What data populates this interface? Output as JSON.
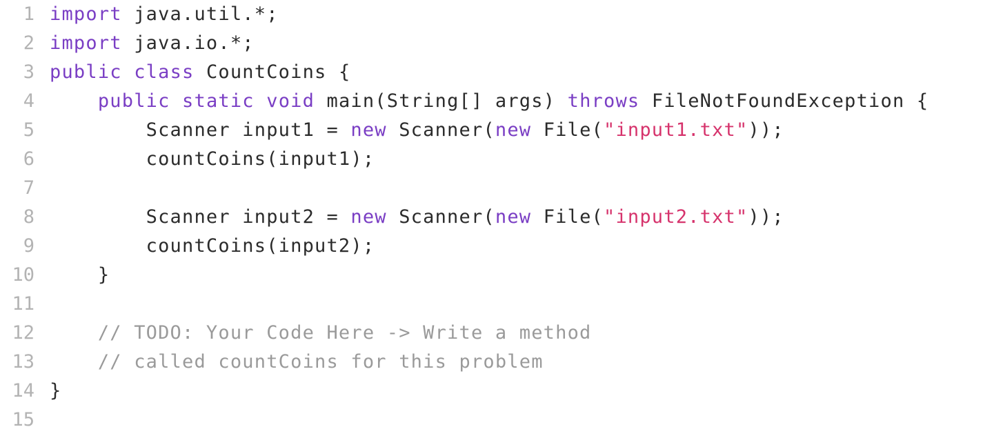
{
  "editor": {
    "language": "java",
    "lines": [
      {
        "number": "1",
        "tokens": [
          {
            "t": "kw",
            "v": "import"
          },
          {
            "t": "plain",
            "v": " java.util.*;"
          }
        ]
      },
      {
        "number": "2",
        "tokens": [
          {
            "t": "kw",
            "v": "import"
          },
          {
            "t": "plain",
            "v": " java.io.*;"
          }
        ]
      },
      {
        "number": "3",
        "tokens": [
          {
            "t": "kw",
            "v": "public"
          },
          {
            "t": "plain",
            "v": " "
          },
          {
            "t": "kw",
            "v": "class"
          },
          {
            "t": "plain",
            "v": " CountCoins {"
          }
        ]
      },
      {
        "number": "4",
        "tokens": [
          {
            "t": "plain",
            "v": "    "
          },
          {
            "t": "kw",
            "v": "public"
          },
          {
            "t": "plain",
            "v": " "
          },
          {
            "t": "kw",
            "v": "static"
          },
          {
            "t": "plain",
            "v": " "
          },
          {
            "t": "kw",
            "v": "void"
          },
          {
            "t": "plain",
            "v": " main(String[] args) "
          },
          {
            "t": "kw",
            "v": "throws"
          },
          {
            "t": "plain",
            "v": " FileNotFoundException {"
          }
        ]
      },
      {
        "number": "5",
        "tokens": [
          {
            "t": "plain",
            "v": "        Scanner input1 = "
          },
          {
            "t": "kw",
            "v": "new"
          },
          {
            "t": "plain",
            "v": " Scanner("
          },
          {
            "t": "kw",
            "v": "new"
          },
          {
            "t": "plain",
            "v": " File("
          },
          {
            "t": "str",
            "v": "\"input1.txt\""
          },
          {
            "t": "plain",
            "v": "));"
          }
        ]
      },
      {
        "number": "6",
        "tokens": [
          {
            "t": "plain",
            "v": "        countCoins(input1);"
          }
        ]
      },
      {
        "number": "7",
        "tokens": []
      },
      {
        "number": "8",
        "tokens": [
          {
            "t": "plain",
            "v": "        Scanner input2 = "
          },
          {
            "t": "kw",
            "v": "new"
          },
          {
            "t": "plain",
            "v": " Scanner("
          },
          {
            "t": "kw",
            "v": "new"
          },
          {
            "t": "plain",
            "v": " File("
          },
          {
            "t": "str",
            "v": "\"input2.txt\""
          },
          {
            "t": "plain",
            "v": "));"
          }
        ]
      },
      {
        "number": "9",
        "tokens": [
          {
            "t": "plain",
            "v": "        countCoins(input2);"
          }
        ]
      },
      {
        "number": "10",
        "tokens": [
          {
            "t": "plain",
            "v": "    }"
          }
        ]
      },
      {
        "number": "11",
        "tokens": []
      },
      {
        "number": "12",
        "tokens": [
          {
            "t": "cmt",
            "v": "    // TODO: Your Code Here -> Write a method"
          }
        ]
      },
      {
        "number": "13",
        "tokens": [
          {
            "t": "cmt",
            "v": "    // called countCoins for this problem"
          }
        ]
      },
      {
        "number": "14",
        "tokens": [
          {
            "t": "plain",
            "v": "}"
          }
        ]
      },
      {
        "number": "15",
        "tokens": []
      }
    ]
  },
  "colors": {
    "keyword": "#7a3ec4",
    "string": "#d6336c",
    "comment": "#9a9a9a",
    "text": "#2b2b2b",
    "line_number": "#b3b3b3"
  }
}
